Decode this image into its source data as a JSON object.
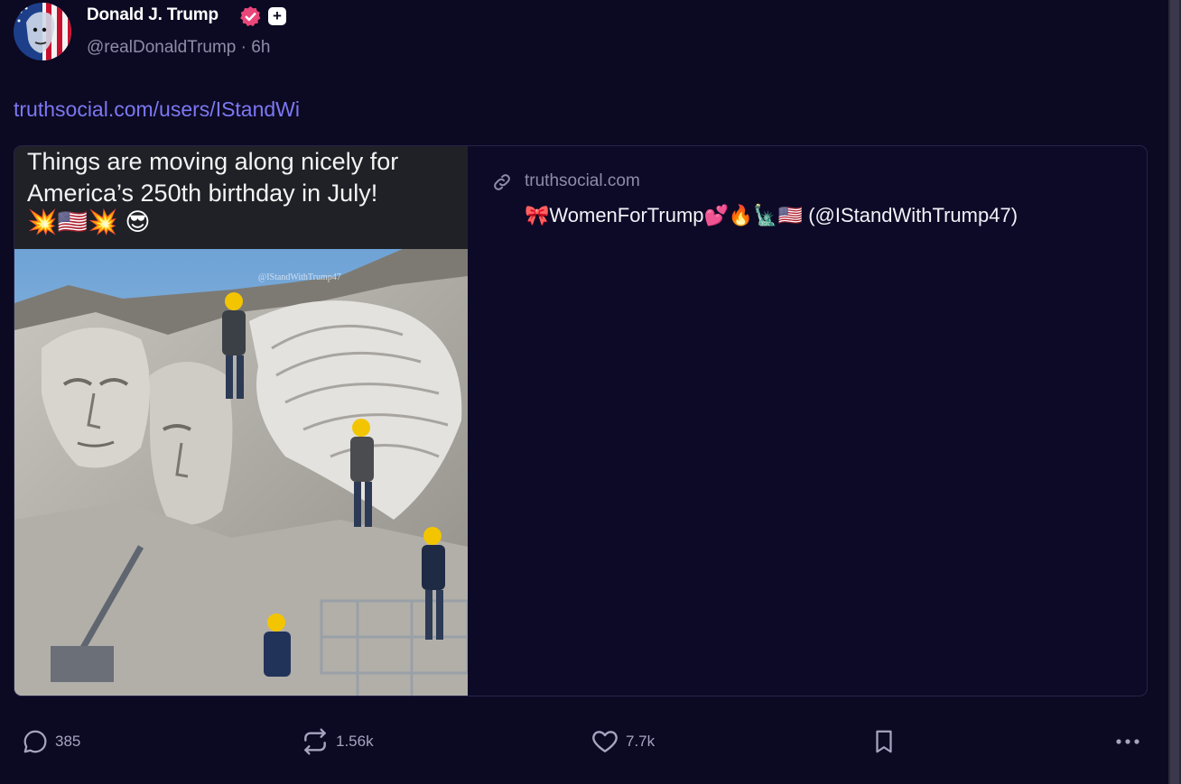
{
  "post": {
    "author": {
      "display_name": "Donald J. Trump",
      "handle": "@realDonaldTrump · 6h",
      "verified_icon": "verified-badge-icon",
      "plus_badge": "+"
    },
    "link_text": "truthsocial.com/users/IStandWi",
    "card": {
      "image_caption": "Things are moving along nicely for\nAmerica’s 250th birthday in July!",
      "image_caption_emoji": "💥🇺🇸💥 😎",
      "image_watermark": "@IStandWithTrump47",
      "domain": "truthsocial.com",
      "title": "🎀WomenForTrump💕🔥🗽🇺🇸 (@IStandWithTrump47)"
    },
    "actions": {
      "reply_count": "385",
      "repost_count": "1.56k",
      "like_count": "7.7k"
    }
  },
  "colors": {
    "background": "#0c0922",
    "card_background": "#0d0a27",
    "link": "#7b78f2",
    "muted": "#8f8ca8",
    "verified": "#e9467a"
  }
}
